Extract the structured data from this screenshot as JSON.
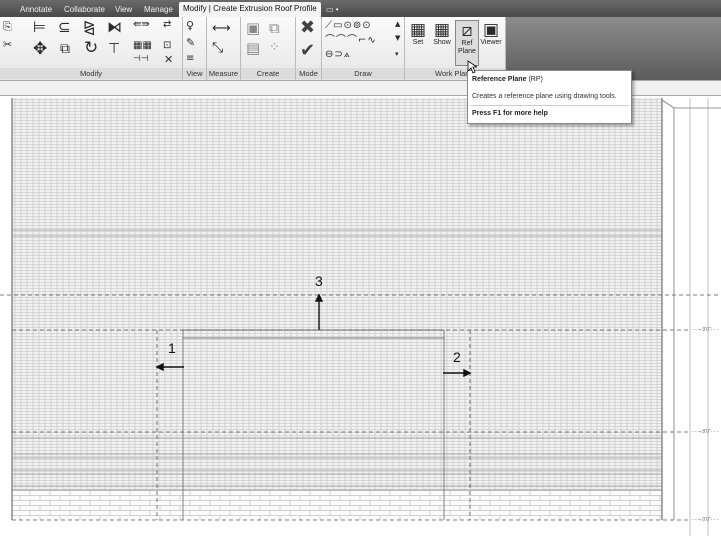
{
  "tabs": {
    "annotate": "Annotate",
    "collaborate": "Collaborate",
    "view": "View",
    "manage": "Manage",
    "active": "Modify | Create Extrusion Roof Profile",
    "extra": "▭ •"
  },
  "panels": {
    "modify": "Modify",
    "view": "View",
    "measure": "Measure",
    "create": "Create",
    "mode": "Mode",
    "draw": "Draw",
    "work_plane": "Work Plane"
  },
  "work_plane_buttons": {
    "set": "Set",
    "show": "Show",
    "ref_plane_line1": "Ref",
    "ref_plane_line2": "Plane",
    "viewer": "Viewer"
  },
  "tooltip": {
    "title": "Reference Plane",
    "shortcut": "(RP)",
    "description": "Creates a reference plane using drawing tools.",
    "help": "Press F1 for more help"
  },
  "callouts": {
    "one": "1",
    "two": "2",
    "three": "3"
  },
  "level_tags": [
    "- - ¬ 9'0\"- - -",
    "- - ¬ 8'0\"- - -",
    "- - ¬ 0'0\"- - -"
  ],
  "icons": {
    "finish": "check-icon",
    "cancel": "close-icon",
    "move": "move-icon",
    "rotate": "rotate-icon"
  },
  "colors": {
    "tab_bar": "#555555",
    "ribbon": "#f0f0f0",
    "hatch": "#c8c8c8",
    "canvas": "#ffffff"
  }
}
